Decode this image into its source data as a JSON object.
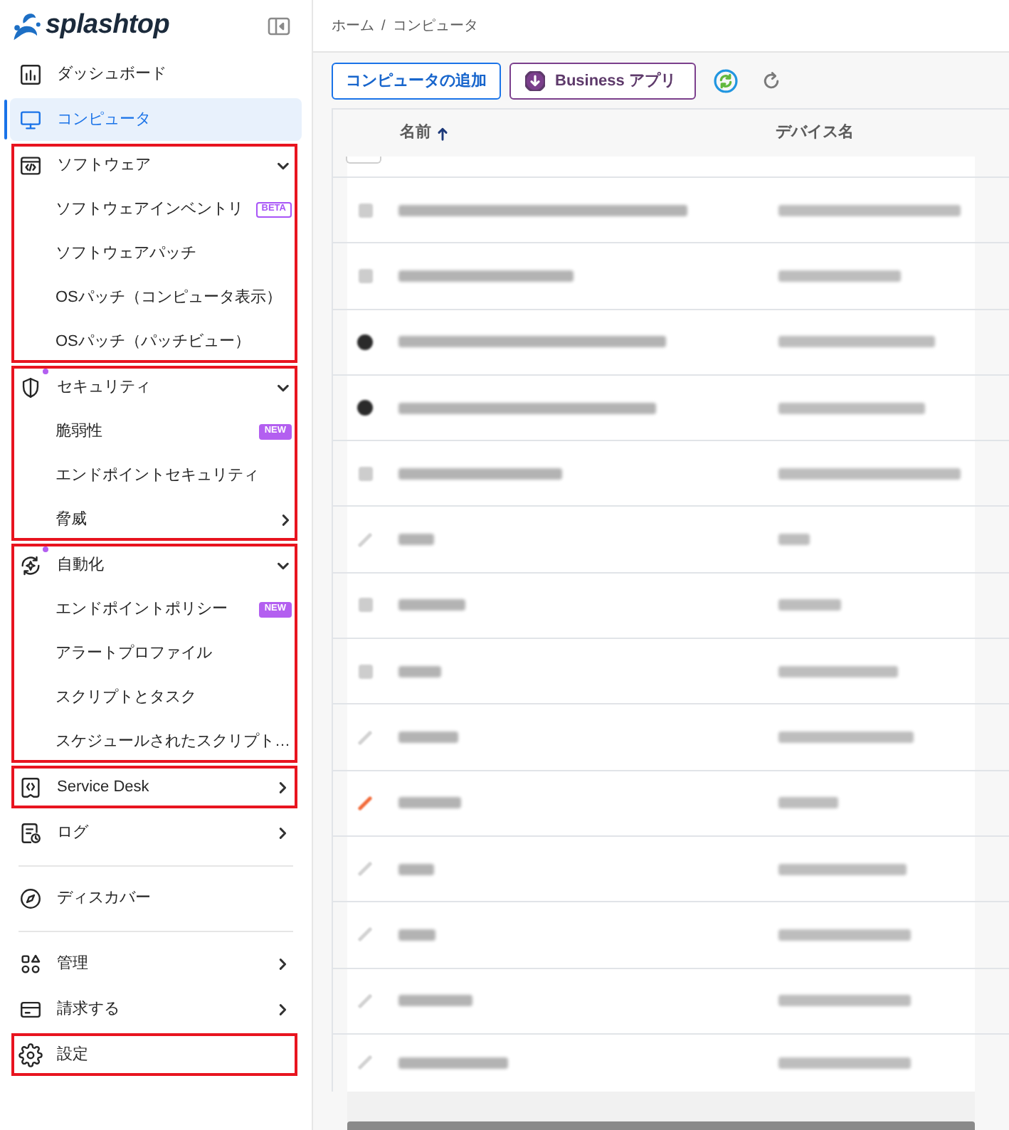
{
  "logo": {
    "text": "splashtop"
  },
  "sidebar": {
    "items": [
      {
        "kind": "link",
        "label": "ダッシュボード",
        "selected": false,
        "highlighted": false,
        "dot": false
      },
      {
        "kind": "link",
        "label": "コンピュータ",
        "selected": true,
        "highlighted": false,
        "dot": false
      },
      {
        "kind": "group",
        "label": "ソフトウェア",
        "selected": false,
        "expanded": true,
        "highlighted": true,
        "dot": false,
        "children": [
          {
            "kind": "link",
            "label": "ソフトウェアインベントリ",
            "selected": false,
            "badge": {
              "kind": "outline",
              "text": "BETA"
            }
          },
          {
            "kind": "link",
            "label": "ソフトウェアパッチ",
            "selected": false
          },
          {
            "kind": "link",
            "label": "OSパッチ（コンピュータ表示）",
            "selected": false
          },
          {
            "kind": "link",
            "label": "OSパッチ（パッチビュー）",
            "selected": false
          }
        ]
      },
      {
        "kind": "group",
        "label": "セキュリティ",
        "selected": false,
        "expanded": true,
        "highlighted": true,
        "dot": true,
        "children": [
          {
            "kind": "link",
            "label": "脆弱性",
            "selected": false,
            "badge": {
              "kind": "filled",
              "text": "NEW"
            }
          },
          {
            "kind": "link",
            "label": "エンドポイントセキュリティ",
            "selected": false
          },
          {
            "kind": "group",
            "label": "脅威",
            "selected": false,
            "expanded": false
          }
        ]
      },
      {
        "kind": "group",
        "label": "自動化",
        "selected": false,
        "expanded": true,
        "highlighted": true,
        "dot": true,
        "children": [
          {
            "kind": "link",
            "label": "エンドポイントポリシー",
            "selected": false,
            "badge": {
              "kind": "filled",
              "text": "NEW"
            }
          },
          {
            "kind": "link",
            "label": "アラートプロファイル",
            "selected": false
          },
          {
            "kind": "link",
            "label": "スクリプトとタスク",
            "selected": false
          },
          {
            "kind": "link",
            "label": "スケジュールされたスクリプト…",
            "selected": false
          }
        ]
      },
      {
        "kind": "group",
        "label": "Service Desk",
        "selected": false,
        "expanded": false,
        "highlighted": true,
        "dot": false
      },
      {
        "kind": "group",
        "label": "ログ",
        "selected": false,
        "expanded": false,
        "highlighted": false,
        "dot": false
      },
      {
        "kind": "divider"
      },
      {
        "kind": "link",
        "label": "ディスカバー",
        "selected": false,
        "highlighted": false,
        "dot": false
      },
      {
        "kind": "divider"
      },
      {
        "kind": "group",
        "label": "管理",
        "selected": false,
        "expanded": false,
        "highlighted": false,
        "dot": false
      },
      {
        "kind": "group",
        "label": "請求する",
        "selected": false,
        "expanded": false,
        "highlighted": false,
        "dot": false
      },
      {
        "kind": "link",
        "label": "設定",
        "selected": false,
        "highlighted": true,
        "dot": false
      }
    ]
  },
  "breadcrumb": {
    "items": [
      "ホーム",
      "コンピュータ"
    ],
    "separator": "/"
  },
  "toolbar": {
    "buttons": [
      {
        "kind": "outline",
        "label": "コンピュータの追加"
      },
      {
        "kind": "app",
        "label": "Business アプリ"
      }
    ]
  },
  "table": {
    "columns": [
      {
        "label": "名前",
        "sorted": true
      },
      {
        "label": "デバイス名",
        "sorted": false
      }
    ],
    "cropped_row": {
      "checked": false
    },
    "rows": [
      {
        "kind": "tile"
      },
      {
        "kind": "tile"
      },
      {
        "kind": "disc"
      },
      {
        "kind": "disc"
      },
      {
        "kind": "tile"
      },
      {
        "kind": "stroke"
      },
      {
        "kind": "tile"
      },
      {
        "kind": "tile"
      },
      {
        "kind": "stroke"
      },
      {
        "kind": "alert"
      },
      {
        "kind": "stroke"
      },
      {
        "kind": "stroke"
      },
      {
        "kind": "stroke"
      },
      {
        "kind": "stroke"
      }
    ]
  }
}
